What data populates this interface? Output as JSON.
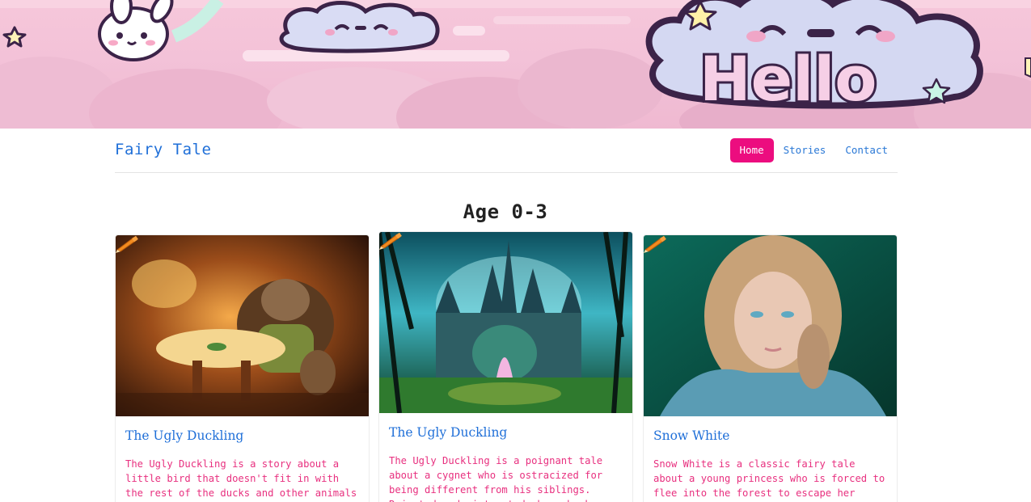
{
  "banner": {
    "hello_text": "Hello"
  },
  "navbar": {
    "brand": "Fairy Tale",
    "links": [
      {
        "label": "Home",
        "active": true
      },
      {
        "label": "Stories",
        "active": false
      },
      {
        "label": "Contact",
        "active": false
      }
    ]
  },
  "section": {
    "title": "Age 0-3"
  },
  "cards": [
    {
      "title": "The Ugly Duckling",
      "text": "The Ugly Duckling is a story about a little bird that doesn't fit in with the rest of the ducks and other animals on",
      "icon": "pencil-icon"
    },
    {
      "title": "The Ugly Duckling",
      "text": "The Ugly Duckling is a poignant tale about a cygnet who is ostracized for being different from his siblings. Rejected and mistreated, he embarks on a",
      "icon": "pencil-icon"
    },
    {
      "title": "Snow White",
      "text": "Snow White is a classic fairy tale about a young princess who is forced to flee into the forest to escape her jealous",
      "icon": "pencil-icon"
    }
  ],
  "colors": {
    "accent": "#ec0d7f",
    "link": "#1f6fd8",
    "card_text": "#e8307f"
  }
}
